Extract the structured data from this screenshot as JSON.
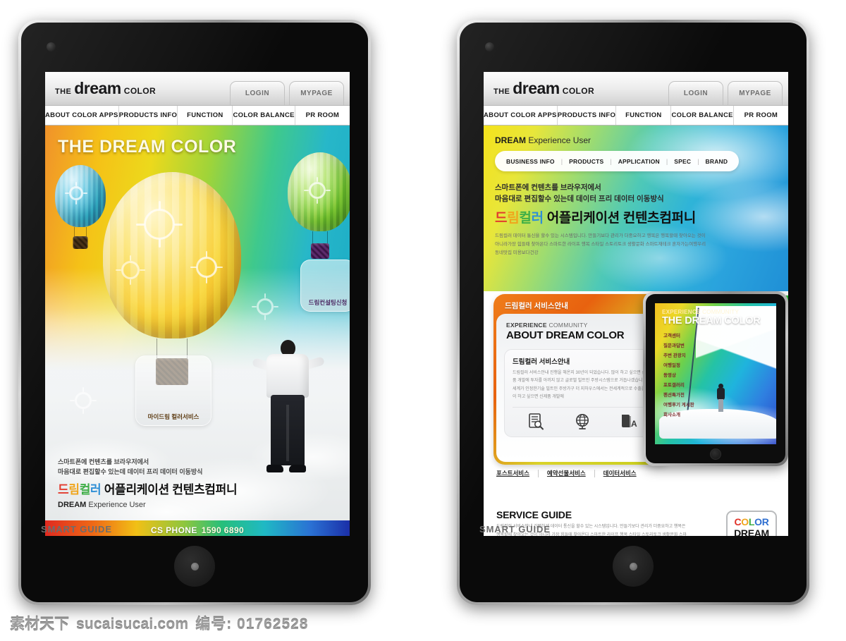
{
  "site": {
    "logo": {
      "the": "THE",
      "dream": "dream",
      "color": "COLOR"
    },
    "header_tabs": [
      "LOGIN",
      "MYPAGE"
    ],
    "nav": [
      "ABOUT COLOR APPS",
      "PRODUCTS INFO",
      "FUNCTION",
      "COLOR BALANCE",
      "PR ROOM"
    ],
    "footer_bar": {
      "label": "CS PHONE",
      "number": "1590 6890"
    }
  },
  "device": {
    "smart_guide": "SMART GUIDE"
  },
  "left_screen": {
    "hero_title": "THE DREAM COLOR",
    "badges": [
      {
        "label": "마이드림 컬러서비스"
      },
      {
        "label": "드림컨설팅신청"
      }
    ],
    "copy": {
      "line1": "스마트폰에 컨텐츠를 브라우저에서",
      "line2": "마음대로 편집할수 있는데 데이터 프리 데이터 이동방식",
      "headline_k1": "드",
      "headline_k2": "림",
      "headline_k3": "컬",
      "headline_k4": "러",
      "headline_rest": " 어플리케이션 컨텐츠컴퍼니",
      "sub_bold": "DREAM",
      "sub_rest": " Experience User"
    }
  },
  "right_screen": {
    "eyebrow_bold": "DREAM",
    "eyebrow_rest": " Experience User",
    "pill_nav": [
      "BUSINESS INFO",
      "PRODUCTS",
      "APPLICATION",
      "SPEC",
      "BRAND"
    ],
    "copy": {
      "line1": "스마트폰에 컨텐츠를 브라우저에서",
      "line2": "마음대로 편집할수 있는데 데이터 프리 데이터 이동방식",
      "headline_k1": "드",
      "headline_k2": "림",
      "headline_k3": "컬",
      "headline_k4": "러",
      "headline_rest": " 어플리케이션 컨텐츠컴퍼니",
      "small": "드림컬러 데이터 통신을 할수 있는 시스템입니다. 만들기보다 관리가 더중요하고 행복은 행복할때 찾아오는 것이 아니라가장 힘들때 찾아온다 스마트한 라이프 행복 스타일 스토리토크 생활문화 스마트재테크 혼자가는여행우리동네맛집 미용보다건강"
    },
    "service_card": {
      "title": "드림컬러 서비스안내",
      "eyebrow_bold": "EXPERIENCE",
      "eyebrow_rest": " COMMUNITY",
      "heading": "ABOUT DREAM COLOR",
      "box_title": "드림컬러 서비스안내",
      "box_text": "드림컬러 서비스안내 진행을 해온지 30년이 되었습니다. 많이 하고 싶으면 신제품 개발에 투자를 아끼지 않고 글로벌 빌트인 주방시스템으로 거듭나겠습니다. 세계가 인정한기술 빌트인 주방가구 더 지하우스에서는 전세계적으로 수출을 많이 하고 싶으면 신제품 개발에",
      "icons": [
        "notepad-search-icon",
        "globe-icon",
        "book-translate-icon"
      ],
      "links": [
        "포스트서비스",
        "예약선물서비스",
        "데이터서비스"
      ]
    },
    "mini_tablet": {
      "eyebrow_bold": "EXPERIENCE",
      "eyebrow_rest": " COMMUNITY",
      "heading": "THE DREAM COLOR",
      "menu": [
        "고객센터",
        "질문과답변",
        "주변 관광지",
        "여행일정",
        "동영상",
        "포토갤러리",
        "팬션특가전",
        "여행후기 게시판",
        "회사소개"
      ]
    },
    "service_guide": {
      "title": "SERVICE GUIDE",
      "text": "드림컬러 서비스안내 간편하게 데이터 통신을 할수 있는 시스템입니다. 만들기보다 관리가 더중요하고 행복은 행복할때 찾아오는 것이 아니라 가장 힘들때 찾아온다 스마트한 라이프 행복 스타일 스토리토크 생활문화 스마트재테크 혼자가는여행",
      "bubble": {
        "c1": "C",
        "c2": "O",
        "c3": "L",
        "c4": "OR",
        "word2": "DREAM"
      }
    }
  },
  "watermark": {
    "cn": "素材天下",
    "site": "sucaisucai.com",
    "num": "编号: 01762528"
  }
}
